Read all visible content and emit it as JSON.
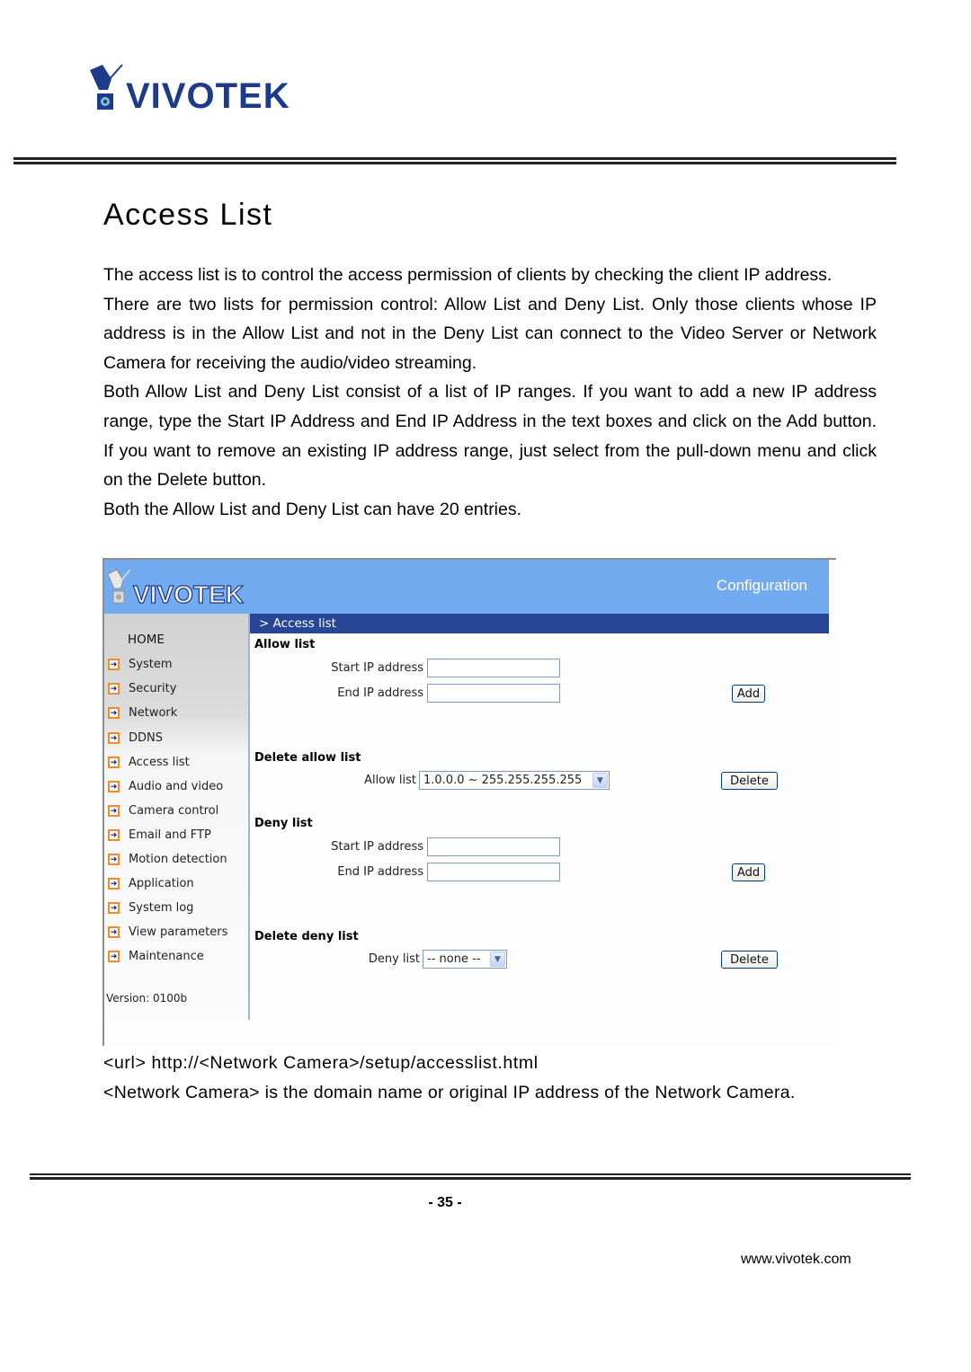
{
  "header": {
    "brand": "VIVOTEK"
  },
  "page": {
    "title": "Access List",
    "paragraphs": [
      "The access list is to control the access permission of clients by checking the client IP address.",
      "There are two lists for permission control: Allow List and Deny List. Only those clients whose IP address is in the Allow List and not in the Deny List can connect to the Video Server or Network Camera for receiving the audio/video streaming.",
      "Both Allow List and Deny List consist of a list of IP ranges. If you want to add a new IP address range, type the Start IP Address and End IP Address in the text boxes and click on the Add button. If you want to remove an existing IP address range, just select from the pull-down menu and click on the Delete button.",
      "Both the Allow List and Deny List can have 20 entries."
    ],
    "url_line": "<url> http://<Network Camera>/setup/accesslist.html",
    "note_line": "<Network Camera> is the domain name or original IP address of the Network Camera.",
    "page_number": "- 35 -",
    "footer_url": "www.vivotek.com"
  },
  "screenshot": {
    "brand": "VIVOTEK",
    "header_title": "Configuration",
    "breadcrumb": "> Access list",
    "sidebar": {
      "home": "HOME",
      "items": [
        {
          "label": "System"
        },
        {
          "label": "Security"
        },
        {
          "label": "Network"
        },
        {
          "label": "DDNS"
        },
        {
          "label": "Access list"
        },
        {
          "label": "Audio and video"
        },
        {
          "label": "Camera control"
        },
        {
          "label": "Email and FTP"
        },
        {
          "label": "Motion detection"
        },
        {
          "label": "Application"
        },
        {
          "label": "System log"
        },
        {
          "label": "View parameters"
        },
        {
          "label": "Maintenance"
        }
      ],
      "version": "Version: 0100b"
    },
    "allow_list": {
      "title": "Allow list",
      "start_label": "Start IP address",
      "start_value": "",
      "end_label": "End IP address",
      "end_value": "",
      "add_label": "Add"
    },
    "delete_allow_list": {
      "title": "Delete allow list",
      "select_label": "Allow list",
      "selected": "1.0.0.0 ~ 255.255.255.255",
      "delete_label": "Delete"
    },
    "deny_list": {
      "title": "Deny list",
      "start_label": "Start IP address",
      "start_value": "",
      "end_label": "End IP address",
      "end_value": "",
      "add_label": "Add"
    },
    "delete_deny_list": {
      "title": "Delete deny list",
      "select_label": "Deny list",
      "selected": "-- none --",
      "delete_label": "Delete"
    },
    "colors": {
      "header_bg": "#72abf0",
      "breadcrumb_bg": "#284696",
      "arrow_border": "#f08a2a"
    }
  }
}
